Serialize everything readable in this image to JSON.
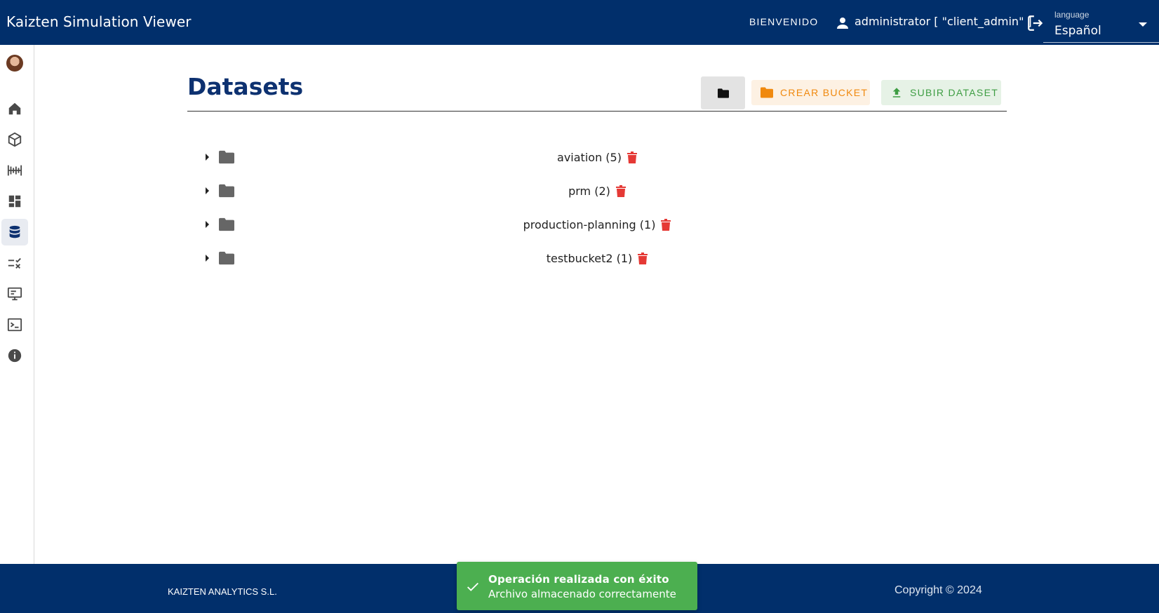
{
  "header": {
    "app_title": "Kaizten Simulation Viewer",
    "welcome": "BIENVENIDO",
    "user": "administrator [ \"client_admin\" ]",
    "language_label": "language",
    "language_value": "Español"
  },
  "sidebar": {
    "items": [
      {
        "icon": "home-icon"
      },
      {
        "icon": "cube-icon"
      },
      {
        "icon": "timeline-icon"
      },
      {
        "icon": "dashboard-icon"
      },
      {
        "icon": "database-icon",
        "active": true
      },
      {
        "icon": "rule-icon"
      },
      {
        "icon": "monitor-icon"
      },
      {
        "icon": "terminal-icon"
      },
      {
        "icon": "info-icon"
      }
    ]
  },
  "main": {
    "title": "Datasets",
    "create_bucket_label": "CREAR BUCKET",
    "upload_dataset_label": "SUBIR DATASET",
    "buckets": [
      {
        "label": "aviation (5)"
      },
      {
        "label": "prm (2)"
      },
      {
        "label": "production-planning (1)"
      },
      {
        "label": "testbucket2 (1)"
      }
    ]
  },
  "footer": {
    "company": "KAIZTEN ANALYTICS S.L.",
    "copyright": "Copyright © 2024"
  },
  "toast": {
    "title": "Operación realizada con éxito",
    "message": "Archivo almacenado correctamente"
  },
  "colors": {
    "primary": "#012f6b",
    "create_accent": "#f0890e",
    "upload_accent": "#3e9d43",
    "delete": "#e53935",
    "toast_success": "#4caf50"
  }
}
